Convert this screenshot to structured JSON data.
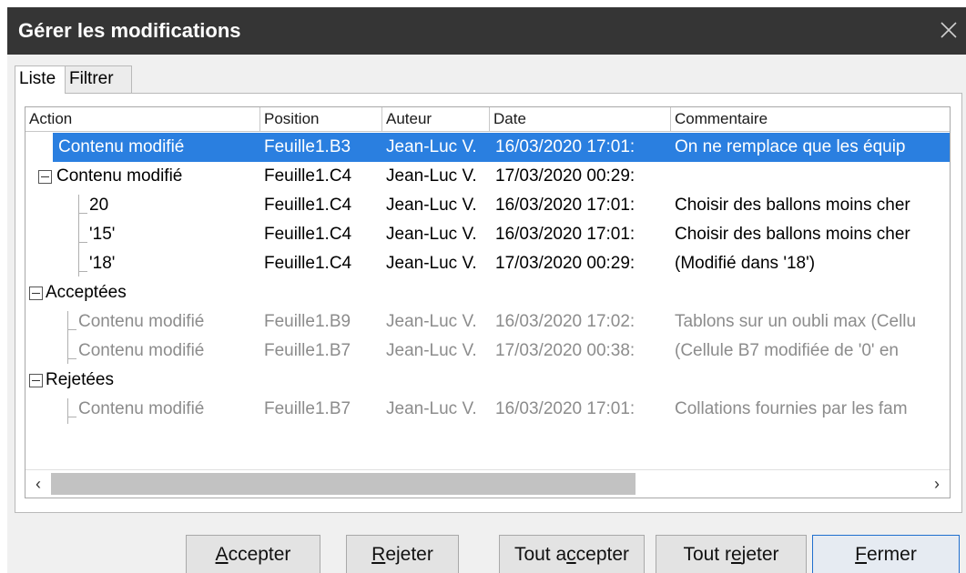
{
  "window": {
    "title": "Gérer les modifications"
  },
  "tabs": [
    {
      "label": "Liste",
      "active": true
    },
    {
      "label": "Filtrer",
      "active": false
    }
  ],
  "columns": [
    "Action",
    "Position",
    "Auteur",
    "Date",
    "Commentaire"
  ],
  "rows": [
    {
      "action": "Contenu modifié",
      "position": "Feuille1.B3",
      "auteur": "Jean-Luc V.",
      "date": "16/03/2020 17:01:",
      "commentaire": "On ne remplace que les équip",
      "selected": true
    },
    {
      "action": "Contenu modifié",
      "position": "Feuille1.C4",
      "auteur": "Jean-Luc V.",
      "date": "17/03/2020 00:29:",
      "commentaire": ""
    },
    {
      "action": "20",
      "position": "Feuille1.C4",
      "auteur": "Jean-Luc V.",
      "date": "16/03/2020 17:01:",
      "commentaire": "Choisir des ballons moins cher"
    },
    {
      "action": "'15'",
      "position": "Feuille1.C4",
      "auteur": "Jean-Luc V.",
      "date": "16/03/2020 17:01:",
      "commentaire": "Choisir des ballons moins cher"
    },
    {
      "action": "'18'",
      "position": "Feuille1.C4",
      "auteur": "Jean-Luc V.",
      "date": "17/03/2020 00:29:",
      "commentaire": "(Modifié dans '18')"
    },
    {
      "action": "Acceptées"
    },
    {
      "action": "Contenu modifié",
      "position": "Feuille1.B9",
      "auteur": "Jean-Luc V.",
      "date": "16/03/2020 17:02:",
      "commentaire": "Tablons sur un oubli max (Cellu"
    },
    {
      "action": "Contenu modifié",
      "position": "Feuille1.B7",
      "auteur": "Jean-Luc V.",
      "date": "17/03/2020 00:38:",
      "commentaire": "(Cellule B7 modifiée de '0' en"
    },
    {
      "action": "Rejetées"
    },
    {
      "action": "Contenu modifié",
      "position": "Feuille1.B7",
      "auteur": "Jean-Luc V.",
      "date": "16/03/2020 17:01:",
      "commentaire": "Collations fournies par les fam"
    }
  ],
  "buttons": {
    "accept": {
      "pre": "",
      "u": "A",
      "post": "ccepter"
    },
    "reject": {
      "pre": "",
      "u": "R",
      "post": "ejeter"
    },
    "accept_all": {
      "pre": "Tout a",
      "u": "c",
      "post": "cepter"
    },
    "reject_all": {
      "pre": "Tout r",
      "u": "e",
      "post": "jeter"
    },
    "close": {
      "pre": "",
      "u": "F",
      "post": "ermer"
    }
  },
  "colors": {
    "selection": "#2a7fe0",
    "titlebar": "#353535",
    "inactive_text": "#8c8c8c"
  }
}
